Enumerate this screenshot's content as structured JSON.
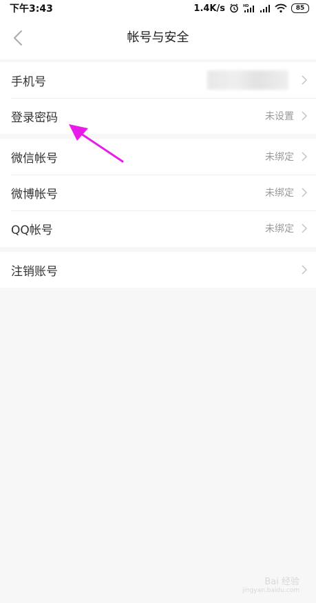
{
  "status_bar": {
    "time": "下午3:43",
    "net_speed": "1.4K/s",
    "battery": "85",
    "icons": [
      "alarm-icon",
      "hd-signal-icon",
      "signal-icon",
      "wifi-icon",
      "battery-icon"
    ]
  },
  "header": {
    "title": "帐号与安全",
    "back_icon": "chevron-left-icon"
  },
  "groups": [
    [
      {
        "label": "手机号",
        "value": "",
        "masked": true
      },
      {
        "label": "登录密码",
        "value": "未设置"
      }
    ],
    [
      {
        "label": "微信帐号",
        "value": "未绑定"
      },
      {
        "label": "微博帐号",
        "value": "未绑定"
      },
      {
        "label": "QQ帐号",
        "value": "未绑定"
      }
    ],
    [
      {
        "label": "注销账号",
        "value": ""
      }
    ]
  ],
  "colors": {
    "background": "#f7f7f7",
    "card": "#ffffff",
    "value_text": "#999999",
    "annotation_arrow": "#e81ce8"
  },
  "watermark": {
    "text": "Bai 经验",
    "sub": "jingyan.baidu.com"
  }
}
